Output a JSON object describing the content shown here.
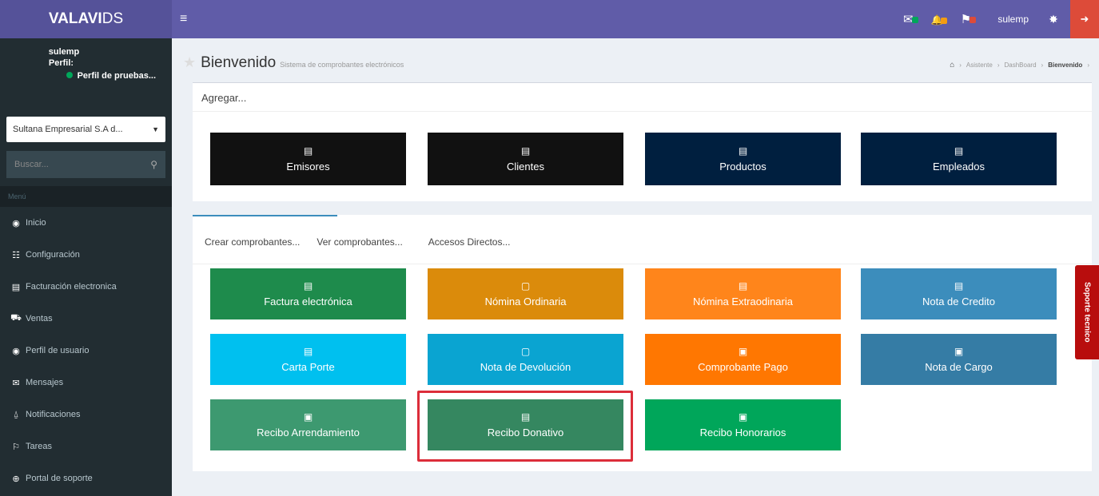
{
  "app": {
    "brand_bold": "VALAVI",
    "brand_rest": " DS"
  },
  "topbar": {
    "hamburger": "≡",
    "user": "sulemp",
    "notifications": [
      {
        "name": "envelope",
        "icon": "✉",
        "dot_color": "#00a65a"
      },
      {
        "name": "bell",
        "icon": "🔔",
        "dot_color": "#f39c12"
      },
      {
        "name": "flag",
        "icon": "⚑",
        "dot_color": "#dd4b39"
      }
    ]
  },
  "sidebar": {
    "user_name": "sulemp",
    "profile_label": "Perfil:",
    "profile_value": "Perfil de pruebas...",
    "company": "Sultana Empresarial S.A d...",
    "search_placeholder": "Buscar...",
    "menu_header": "Menú",
    "items": [
      {
        "label": "Inicio",
        "icon": "◉"
      },
      {
        "label": "Configuración",
        "icon": "☷"
      },
      {
        "label": "Facturación electronica",
        "icon": "▤"
      },
      {
        "label": "Ventas",
        "icon": "⛟"
      },
      {
        "label": "Perfil de usuario",
        "icon": "◉"
      },
      {
        "label": "Mensajes",
        "icon": "✉"
      },
      {
        "label": "Notificaciones",
        "icon": "⍙"
      },
      {
        "label": "Tareas",
        "icon": "⚐"
      },
      {
        "label": "Portal de soporte",
        "icon": "⊕"
      }
    ]
  },
  "header": {
    "title": "Bienvenido",
    "subtitle": "Sistema de comprobantes electrónicos",
    "breadcrumb": [
      "Asistente",
      "DashBoard",
      "Bienvenido"
    ]
  },
  "agregar": {
    "title": "Agregar...",
    "buttons": [
      {
        "label": "Emisores",
        "color": "#111111"
      },
      {
        "label": "Clientes",
        "color": "#111111"
      },
      {
        "label": "Productos",
        "color": "#001f3f"
      },
      {
        "label": "Empleados",
        "color": "#001f3f"
      }
    ]
  },
  "tabs": [
    "Crear comprobantes...",
    "Ver comprobantes...",
    "Accesos Directos..."
  ],
  "comprobantes": [
    {
      "label": "Factura electrónica",
      "color": "#1e8b4c",
      "icon": "▤"
    },
    {
      "label": "Nómina Ordinaria",
      "color": "#db8b0b",
      "icon": "▢"
    },
    {
      "label": "Nómina Extraodinaria",
      "color": "#ff851b",
      "icon": "▤"
    },
    {
      "label": "Nota de Credito",
      "color": "#3c8dbc",
      "icon": "▤"
    },
    {
      "label": "Carta Porte",
      "color": "#00c0ef",
      "icon": "▤"
    },
    {
      "label": "Nota de Devolución",
      "color": "#0aa4d1",
      "icon": "▢"
    },
    {
      "label": "Comprobante Pago",
      "color": "#ff7701",
      "icon": "▣"
    },
    {
      "label": "Nota de Cargo",
      "color": "#357ca5",
      "icon": "▣"
    },
    {
      "label": "Recibo Arrendamiento",
      "color": "#3d9970",
      "icon": "▣"
    },
    {
      "label": "Recibo Donativo",
      "color": "#358760",
      "icon": "▤"
    },
    {
      "label": "Recibo Honorarios",
      "color": "#00a65a",
      "icon": "▣"
    }
  ],
  "support_tab": "Soporte tecnico"
}
